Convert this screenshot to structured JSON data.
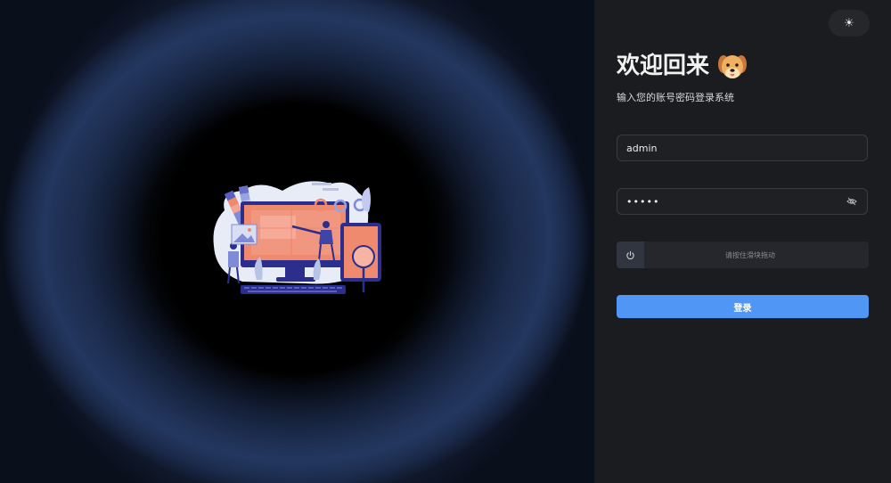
{
  "header": {
    "theme_toggle_icon": "sun-icon",
    "theme_toggle_glyph": "☀"
  },
  "login": {
    "title": "欢迎回来",
    "title_emoji_icon": "dog-face-icon",
    "subtitle": "输入您的账号密码登录系统",
    "username_value": "admin",
    "password_value": "•••••",
    "password_toggle_icon": "eye-icon",
    "slider_icon": "power-icon",
    "slider_text": "请按住滑块拖动",
    "submit_label": "登录"
  },
  "illustration": {
    "icon": "designer-workspace-illustration"
  },
  "colors": {
    "primary": "#5096f5",
    "panel_bg": "#1b1c1f",
    "left_bg": "#000000",
    "glow": "#223760"
  }
}
